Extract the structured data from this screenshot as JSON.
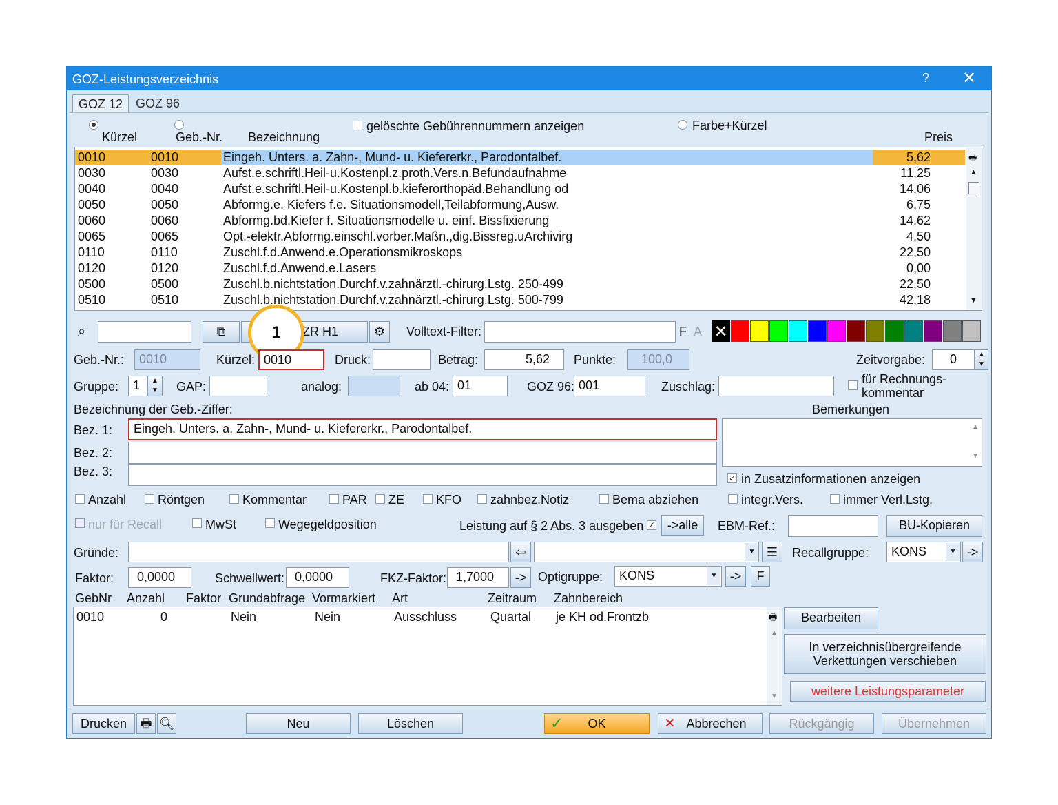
{
  "window": {
    "title": "GOZ-Leistungsverzeichnis",
    "help": "?",
    "close": "✕"
  },
  "tabs": [
    {
      "label": "GOZ 12"
    },
    {
      "label": "GOZ 96"
    }
  ],
  "header": {
    "col_kuerzel": "Kürzel",
    "col_gebnr": "Geb.-Nr.",
    "col_bez": "Bezeichnung",
    "col_preis": "Preis",
    "deleted_label": "gelöschte Gebührennummern anzeigen",
    "farbe_label": "Farbe+Kürzel"
  },
  "list_rows": [
    {
      "k": "0010",
      "g": "0010",
      "b": "Eingeh. Unters. a. Zahn-, Mund- u. Kiefererkr., Parodontalbef.",
      "p": "5,62"
    },
    {
      "k": "0030",
      "g": "0030",
      "b": "Aufst.e.schriftl.Heil-u.Kostenpl.z.proth.Vers.n.Befundaufnahme",
      "p": "11,25"
    },
    {
      "k": "0040",
      "g": "0040",
      "b": "Aufst.e.schriftl.Heil-u.Kostenpl.b.kieferorthopäd.Behandlung od",
      "p": "14,06"
    },
    {
      "k": "0050",
      "g": "0050",
      "b": "Abformg.e. Kiefers  f.e. Situationsmodell,Teilabformung,Ausw.",
      "p": "6,75"
    },
    {
      "k": "0060",
      "g": "0060",
      "b": "Abformg.bd.Kiefer f. Situationsmodelle u. einf. Bissfixierung",
      "p": "14,62"
    },
    {
      "k": "0065",
      "g": "0065",
      "b": "Opt.-elektr.Abformg.einschl.vorber.Maßn.,dig.Bissreg.uArchivirg",
      "p": "4,50"
    },
    {
      "k": "0110",
      "g": "0110",
      "b": "Zuschl.f.d.Anwend.e.Operationsmikroskops",
      "p": "22,50"
    },
    {
      "k": "0120",
      "g": "0120",
      "b": "Zuschl.f.d.Anwend.e.Lasers",
      "p": "0,00"
    },
    {
      "k": "0500",
      "g": "0500",
      "b": "Zuschl.b.nichtstation.Durchf.v.zahnärztl.-chirurg.Lstg. 250-499",
      "p": "22,50"
    },
    {
      "k": "0510",
      "g": "0510",
      "b": "Zuschl.b.nichtstation.Durchf.v.zahnärztl.-chirurg.Lstg. 500-799",
      "p": "42,18"
    }
  ],
  "toolbar": {
    "combo": "ZR H1",
    "filter_label": "Volltext-Filter:",
    "f": "F",
    "a": "A",
    "callout": "1"
  },
  "colors": [
    "#000000",
    "#ff0000",
    "#ffff00",
    "#00ff00",
    "#00ffff",
    "#0000ff",
    "#ff00ff",
    "#800000",
    "#808000",
    "#008000",
    "#008080",
    "#800080",
    "#808080",
    "#c0c0c0"
  ],
  "fields": {
    "gebnr_label": "Geb.-Nr.:",
    "gebnr": "0010",
    "kuerzel_label": "Kürzel:",
    "kuerzel": "0010",
    "druck_label": "Druck:",
    "druck": "",
    "betrag_label": "Betrag:",
    "betrag": "5,62",
    "punkte_label": "Punkte:",
    "punkte": "100,0",
    "zeit_label": "Zeitvorgabe:",
    "zeit": "0",
    "gruppe_label": "Gruppe:",
    "gruppe": "1",
    "gap_label": "GAP:",
    "analog_label": "analog:",
    "ab04_label": "ab 04:",
    "ab04": "01",
    "goz96_label": "GOZ 96:",
    "goz96": "001",
    "zuschlag_label": "Zuschlag:",
    "rechnung_label_1": "für Rechnungs-",
    "rechnung_label_2": "kommentar",
    "bez_header": "Bezeichnung der Geb.-Ziffer:",
    "bem_header": "Bemerkungen",
    "bez1_label": "Bez. 1:",
    "bez1": "Eingeh. Unters. a. Zahn-, Mund- u. Kiefererkr., Parodontalbef.",
    "bez2_label": "Bez. 2:",
    "bez3_label": "Bez. 3:",
    "zusatz_label": "in Zusatzinformationen anzeigen"
  },
  "checkboxes": [
    "Anzahl",
    "Röntgen",
    "Kommentar",
    "PAR",
    "ZE",
    "KFO",
    "zahnbez.Notiz",
    "Bema abziehen",
    "integr.Vers.",
    "immer Verl.Lstg."
  ],
  "row2": {
    "recall": "nur für Recall",
    "mwst": "MwSt",
    "wege": "Wegegeldposition",
    "leistung": "Leistung auf § 2 Abs. 3 ausgeben",
    "alle": "->alle",
    "ebm_label": "EBM-Ref.:",
    "bu_kopieren": "BU-Kopieren"
  },
  "gruende": {
    "label": "Gründe:",
    "recall_label": "Recallgruppe:",
    "recall_value": "KONS",
    "arrow": "->"
  },
  "faktor": {
    "label": "Faktor:",
    "value": "0,0000",
    "schwell_label": "Schwellwert:",
    "schwell": "0,0000",
    "fkz_label": "FKZ-Faktor:",
    "fkz": "1,7000",
    "arrow": "->",
    "opti_label": "Optigruppe:",
    "opti": "KONS",
    "f": "F"
  },
  "table": {
    "headers": [
      "GebNr",
      "Anzahl",
      "Faktor",
      "Grundabfrage",
      "Vormarkiert",
      "Art",
      "Zeitraum",
      "Zahnbereich"
    ],
    "rows": [
      {
        "c0": "0010",
        "c1": "0",
        "c2": "",
        "c3": "Nein",
        "c4": "Nein",
        "c5": "Ausschluss",
        "c6": "Quartal",
        "c7": "je KH od.Frontzb"
      }
    ]
  },
  "side": {
    "bearbeiten": "Bearbeiten",
    "verk_1": "In verzeichnisübergreifende",
    "verk_2": "Verkettungen verschieben",
    "weitere": "weitere Leistungsparameter"
  },
  "bottom": {
    "drucken": "Drucken",
    "neu": "Neu",
    "loeschen": "Löschen",
    "ok": "OK",
    "abbrechen": "Abbrechen",
    "rueck": "Rückgängig",
    "uebernehmen": "Übernehmen"
  }
}
